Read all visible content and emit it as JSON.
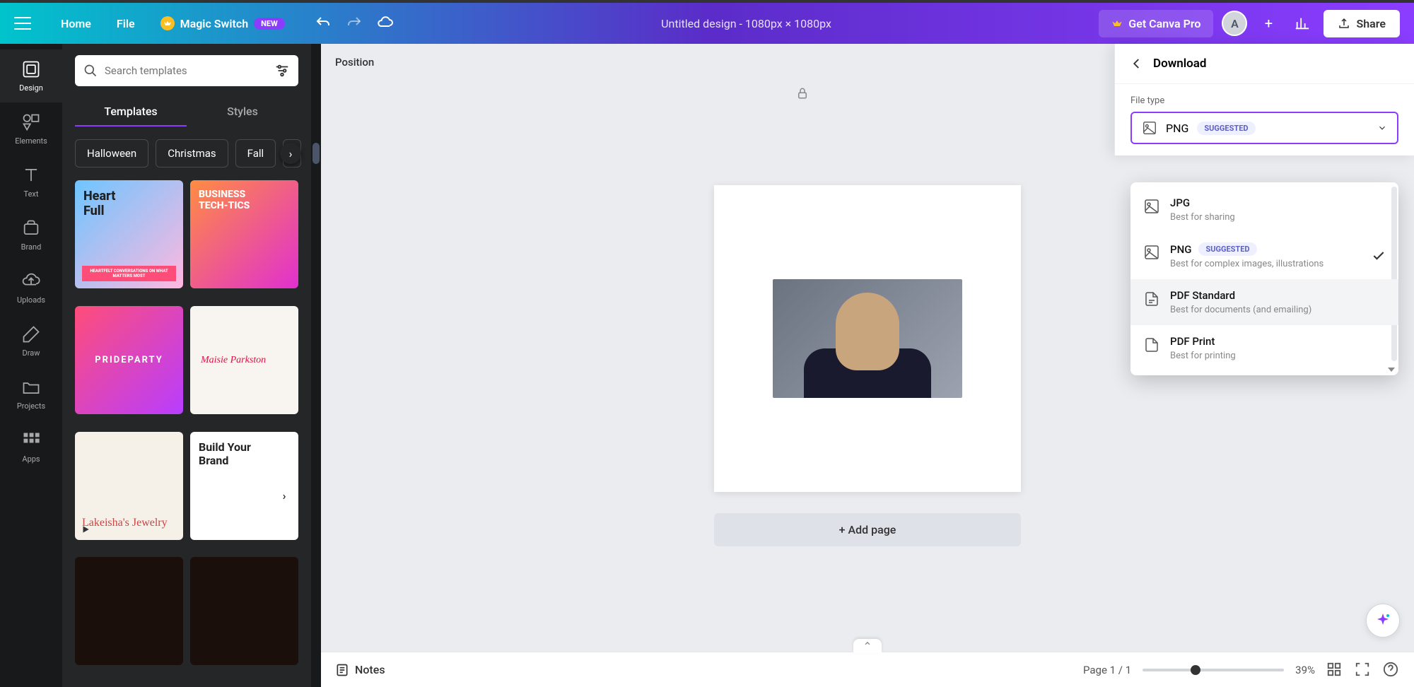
{
  "header": {
    "home": "Home",
    "file": "File",
    "magic_switch": "Magic Switch",
    "new_badge": "NEW",
    "doc_title": "Untitled design - 1080px × 1080px",
    "get_pro": "Get Canva Pro",
    "avatar_initial": "A",
    "share": "Share"
  },
  "vnav": {
    "design": "Design",
    "elements": "Elements",
    "text": "Text",
    "brand": "Brand",
    "uploads": "Uploads",
    "draw": "Draw",
    "projects": "Projects",
    "apps": "Apps"
  },
  "side": {
    "search_placeholder": "Search templates",
    "tab_templates": "Templates",
    "tab_styles": "Styles",
    "chips": {
      "halloween": "Halloween",
      "christmas": "Christmas",
      "fall": "Fall"
    },
    "templates": {
      "t1_line1": "Heart",
      "t1_line2": "Full",
      "t2_line1": "BUSINESS",
      "t2_line2": "TECH-TICS",
      "t1_caption": "HEARTFELT CONVERSATIONS ON WHAT MATTERS MOST",
      "t3_text": "PRIDEPARTY",
      "t4_name": "Maisie Parkston",
      "t5_title": "Lakeisha's Jewelry",
      "t6_line1": "Build Your",
      "t6_line2": "Brand"
    }
  },
  "canvas": {
    "position": "Position",
    "add_page": "+ Add page"
  },
  "footer": {
    "notes": "Notes",
    "page": "Page 1 / 1",
    "zoom": "39%"
  },
  "download": {
    "title": "Download",
    "file_type_label": "File type",
    "selected": "PNG",
    "suggested": "SUGGESTED",
    "options": {
      "jpg_name": "JPG",
      "jpg_desc": "Best for sharing",
      "png_name": "PNG",
      "png_desc": "Best for complex images, illustrations",
      "pdfstd_name": "PDF Standard",
      "pdfstd_desc": "Best for documents (and emailing)",
      "pdfprint_name": "PDF Print",
      "pdfprint_desc": "Best for printing"
    }
  }
}
